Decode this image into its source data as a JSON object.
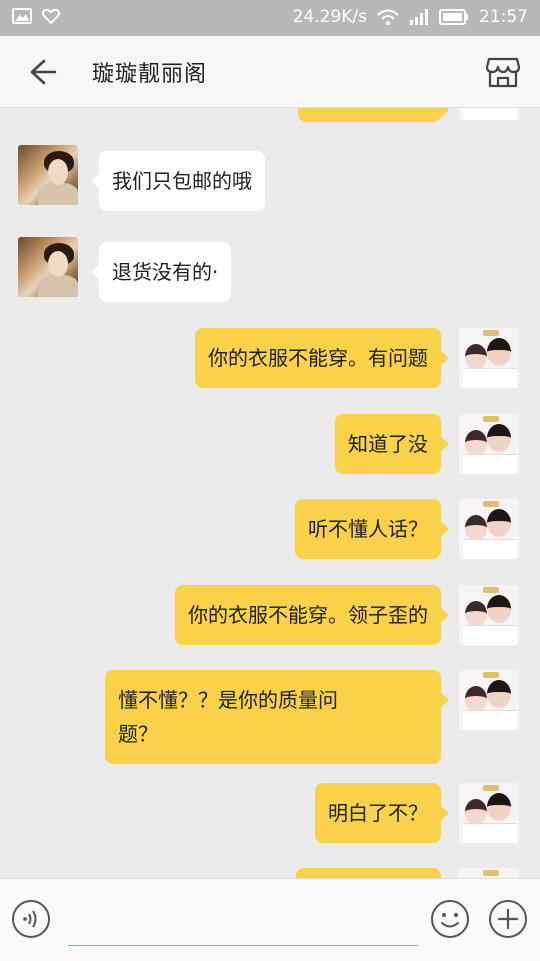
{
  "status_bar": {
    "speed": "24.29K/s",
    "time": "21:57"
  },
  "header": {
    "title": "璇璇靓丽阁"
  },
  "messages": [
    {
      "from": "self",
      "text": ""
    },
    {
      "from": "other",
      "text": "我们只包邮的哦"
    },
    {
      "from": "other",
      "text": "退货没有的·"
    },
    {
      "from": "self",
      "text": "你的衣服不能穿。有问题"
    },
    {
      "from": "self",
      "text": "知道了没"
    },
    {
      "from": "self",
      "text": "听不懂人话？"
    },
    {
      "from": "self",
      "text": "你的衣服不能穿。领子歪的"
    },
    {
      "from": "self",
      "text": "懂不懂？？是你的质量问",
      "text2": "题？"
    },
    {
      "from": "self",
      "text": "明白了不？"
    },
    {
      "from": "self",
      "text": ""
    }
  ],
  "input": {
    "placeholder": ""
  },
  "icons": {
    "back": "back-arrow-icon",
    "shop": "store-icon",
    "voice": "voice-icon",
    "emoji": "emoji-icon",
    "plus": "plus-icon"
  },
  "colors": {
    "self_bubble": "#f9d24a",
    "other_bubble": "#ffffff",
    "background": "#ebebeb"
  }
}
